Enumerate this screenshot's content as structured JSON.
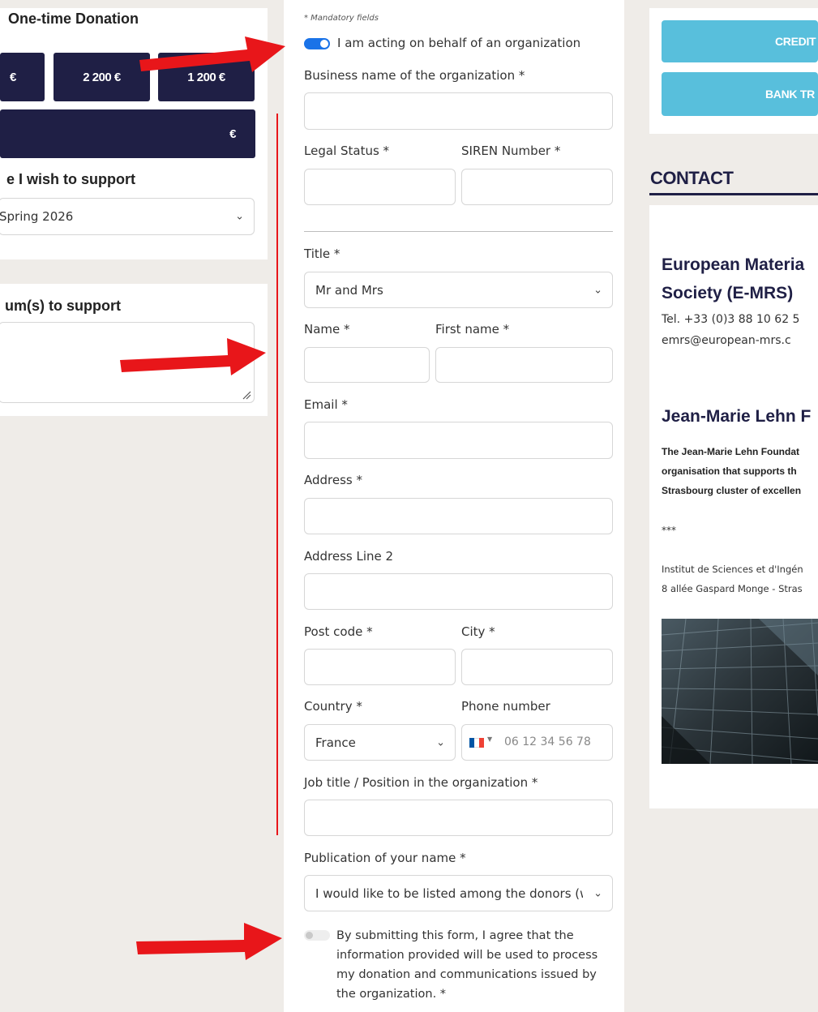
{
  "left": {
    "donation_heading": "One-time Donation",
    "amounts": [
      "€",
      "2 200 €",
      "1 200 €"
    ],
    "custom_amount_suffix": "€",
    "support_heading": "e I wish to support",
    "support_select_value": "Spring 2026",
    "symposium_heading": "um(s) to support"
  },
  "form": {
    "mandatory_note": "* Mandatory fields",
    "org_toggle_label": "I am acting on behalf of an organization",
    "business_name_label": "Business name of the organization *",
    "legal_status_label": "Legal Status *",
    "siren_label": "SIREN Number *",
    "title_label": "Title *",
    "title_value": "Mr and Mrs",
    "name_label": "Name *",
    "first_name_label": "First name *",
    "email_label": "Email *",
    "address_label": "Address *",
    "address2_label": "Address Line 2",
    "postcode_label": "Post code *",
    "city_label": "City *",
    "country_label": "Country *",
    "country_value": "France",
    "phone_label": "Phone number",
    "phone_placeholder": "06 12 34 56 78",
    "job_label": "Job title / Position in the organization *",
    "publication_label": "Publication of your name *",
    "publication_value": "I would like to be listed among the donors (w",
    "consent_text": "By submitting this form, I agree that the information provided will be used to process my donation and communications issued by the organization. *"
  },
  "right": {
    "credit_label": "CREDIT",
    "bank_label": "BANK TR",
    "contact_heading": "CONTACT",
    "org_name_line1": "European Materia",
    "org_name_line2": "Society (E-MRS)",
    "tel": "Tel. +33 (0)3 88 10 62 5",
    "email": "emrs@european-mrs.c",
    "foundation_heading": "Jean-Marie Lehn F",
    "foundation_desc_1": "The Jean-Marie Lehn Foundat",
    "foundation_desc_2": "organisation that supports th",
    "foundation_desc_3": "Strasbourg cluster of excellen",
    "stars": "***",
    "institute_1": "Institut de Sciences et d'Ingén",
    "institute_2": "8 allée Gaspard Monge - Stras"
  },
  "colors": {
    "navy": "#1f1f45",
    "accent_blue": "#1a73e8",
    "pay_blue": "#58bfdc",
    "annotation_red": "#e8161a"
  }
}
